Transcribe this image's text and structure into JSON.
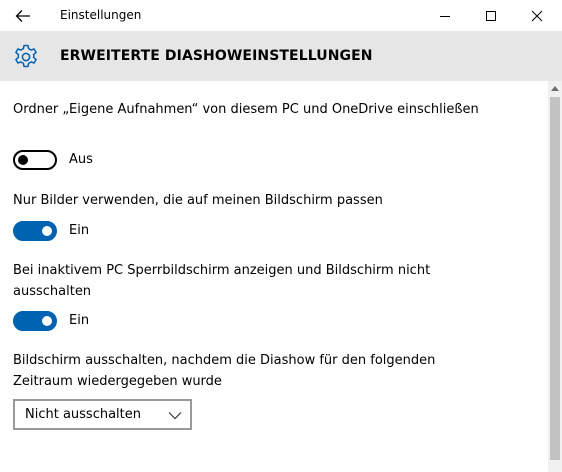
{
  "window": {
    "title": "Einstellungen"
  },
  "header": {
    "title": "ERWEITERTE DIASHOWEINSTELLUNGEN",
    "icon": "gear-icon"
  },
  "settings": [
    {
      "label": "Ordner „Eigene Aufnahmen“ von diesem PC und OneDrive einschließen",
      "state": "Aus",
      "on": false
    },
    {
      "label": "Nur Bilder verwenden, die auf meinen Bildschirm passen",
      "state": "Ein",
      "on": true
    },
    {
      "label": "Bei inaktivem PC Sperrbildschirm anzeigen und Bildschirm nicht ausschalten",
      "state": "Ein",
      "on": true
    }
  ],
  "screen_off": {
    "label": "Bildschirm ausschalten, nachdem die Diashow für den folgenden Zeitraum wiedergegeben wurde",
    "selected": "Nicht ausschalten"
  },
  "colors": {
    "accent": "#0063b1",
    "header_bg": "#e6e6e6",
    "scrollbar_thumb": "#c2c2c2"
  }
}
